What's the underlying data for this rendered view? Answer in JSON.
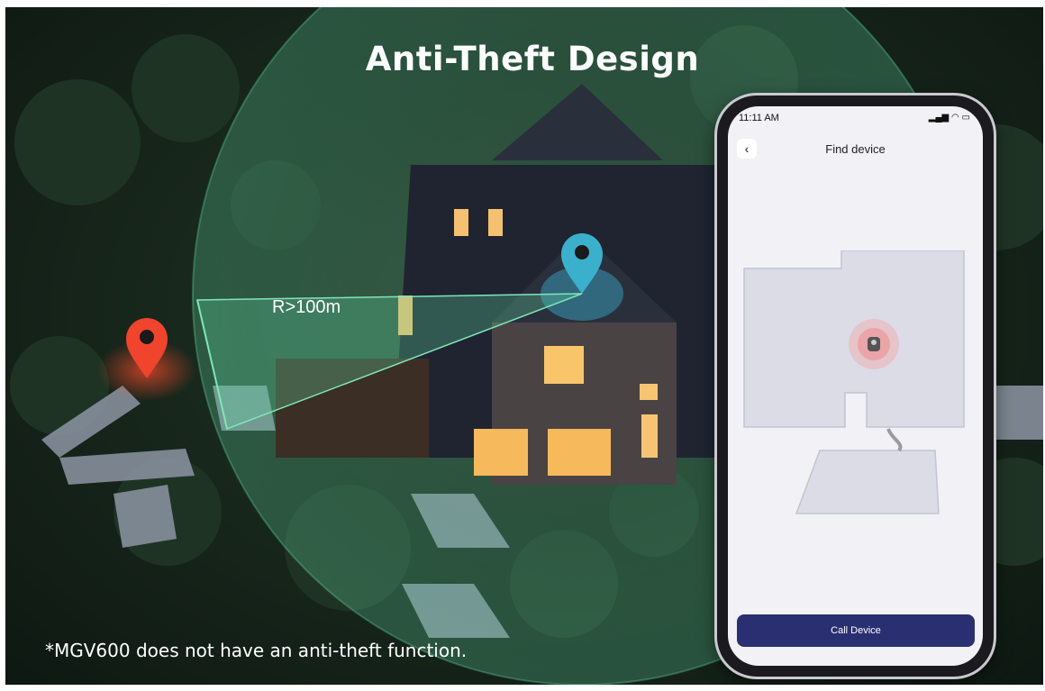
{
  "headline": "Anti-Theft Design",
  "radius_label": "R>100m",
  "footnote": "*MGV600 does not have an anti-theft function.",
  "phone": {
    "status_time": "11:11 AM",
    "screen_title": "Find device",
    "back_icon": "chevron-left-icon",
    "call_button_label": "Call Device"
  },
  "colors": {
    "owner_pin": "#f0442c",
    "device_pin": "#3ab0cc",
    "geofence": "#5fd3a0",
    "call_button": "#2a2f72"
  }
}
